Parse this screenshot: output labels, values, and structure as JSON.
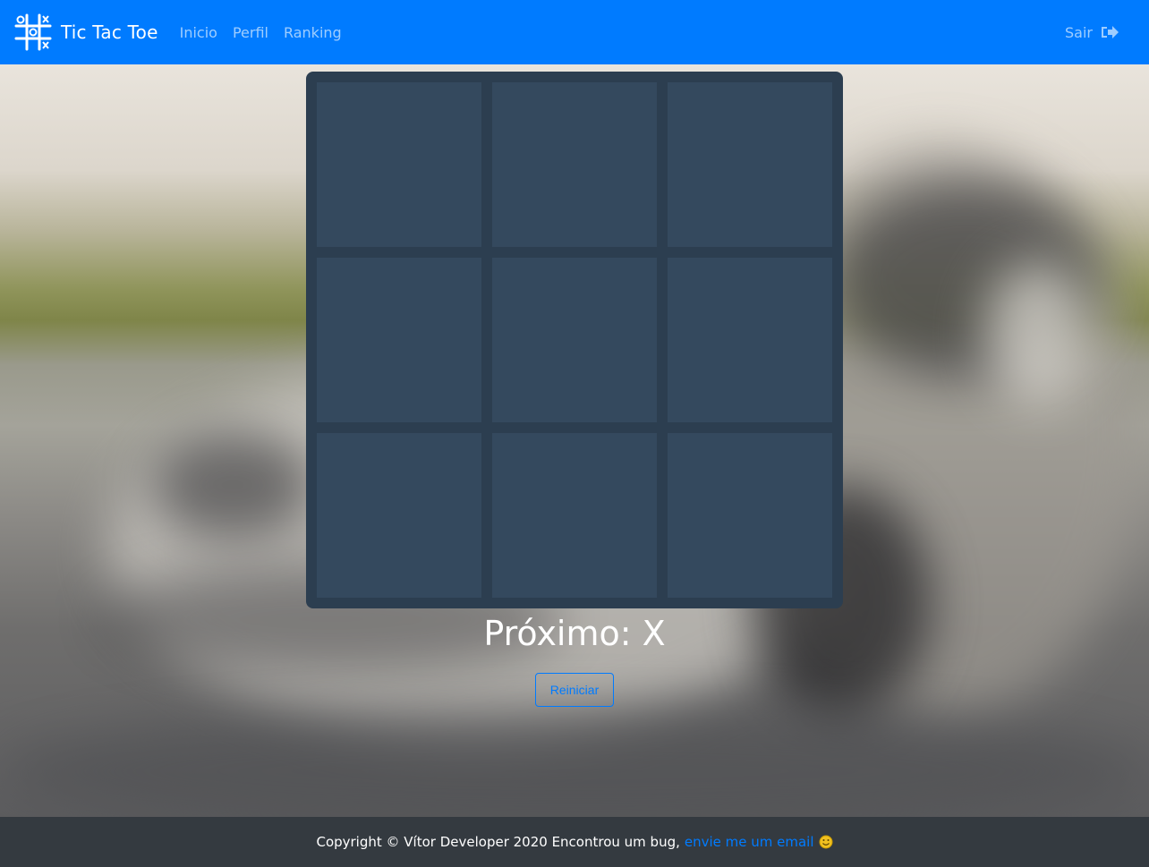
{
  "navbar": {
    "brand": "Tic Tac Toe",
    "links": [
      "Inicio",
      "Perfil",
      "Ranking"
    ],
    "logout_label": "Sair"
  },
  "board": {
    "cells": [
      "",
      "",
      "",
      "",
      "",
      "",
      "",
      "",
      ""
    ]
  },
  "game": {
    "status": "Próximo: X",
    "restart_label": "Reiniciar"
  },
  "footer": {
    "text": "Copyright © Vítor Developer 2020 Encontrou um bug,",
    "link_text": "envie me um email"
  },
  "colors": {
    "navbar": "#007bff",
    "board_bg": "#2c3e50",
    "cell_bg": "#34495e",
    "footer_bg": "#343a40",
    "link": "#007bff"
  }
}
